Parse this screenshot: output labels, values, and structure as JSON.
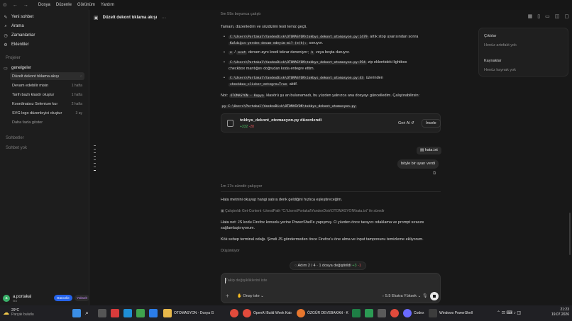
{
  "menubar": {
    "menu": [
      "Dosya",
      "Düzenle",
      "Görünüm",
      "Yardım"
    ]
  },
  "sidebar": {
    "nav": [
      {
        "label": "Yeni sohbet",
        "icon": "pencil-icon"
      },
      {
        "label": "Arama",
        "icon": "search-icon"
      },
      {
        "label": "Zamanlanlar",
        "icon": "clock-icon"
      },
      {
        "label": "Eklentiler",
        "icon": "plugin-icon"
      }
    ],
    "projects_header": "Projeler",
    "project": "genelgeler",
    "items": [
      {
        "label": "Düzelt dekont tıklama akışı",
        "meta": "",
        "active": true
      },
      {
        "label": "Devam edebilir misin",
        "meta": "1 hafta"
      },
      {
        "label": "Tarih bazlı klasör oluştur",
        "meta": "1 hafta"
      },
      {
        "label": "Koordinatsız Selenium kur",
        "meta": "2 hafta"
      },
      {
        "label": "SVG logo düzenleyici oluştur",
        "meta": "3 ay"
      }
    ],
    "show_more": "Daha fazla göster",
    "chats_header": "Sohbetler",
    "no_chats": "Sohbet yok",
    "profile": {
      "initial": "a",
      "name": "a.portakal",
      "plan": "Go",
      "update_label": "Güncelle",
      "upgrade_label": "Yükselt"
    }
  },
  "header": {
    "title": "Düzelt dekont tıklama akışı",
    "more": "···"
  },
  "content": {
    "elapsed_top": "5m 59s boyunca çalıştı",
    "intro": "Tamam, düzenledim ve sözdizimi testi temiz geçti.",
    "b1_code": "C:\\Users\\Portakal\\YandexDisk\\OTOMASYON\\tokbys_dekont_otomasyon.py:1479",
    "b1_text": "artık stop uyarısından sonra",
    "b1_code2": "Kaldığın yerden devam edeyim mi? (e/h):",
    "b1_text2": "soruyor.",
    "b2_code1": "e",
    "b2_sep": "/",
    "b2_code2": "evet",
    "b2_text": "dersen aynı kredi tekrar deneniyor;",
    "b2_code3": "h",
    "b2_text2": "veya boşta duruyor.",
    "b3_code": "C:\\Users\\Portakal\\YandexDisk\\OTOMASYON\\tokbys_dekont_otomasyon.py:594",
    "b3_text": "zip eklentideki lightbox",
    "b3_text2": "checkbox mantığını doğrudan koda entegre ettim.",
    "b4_code": "C:\\Users\\Portakal\\YandexDisk\\OTOMASYON\\tokbys_dekont_otomasyon.py:43",
    "b4_text": "üzerinden",
    "b4_code2": "checkbox_clicker_entegre=True",
    "b4_text2": "aktif.",
    "note_prefix": "Not:",
    "note_code": "OTOMASYON - Kopya",
    "note_text": "klasörü şu an bulunamadı, bu yüzden yalnızca ana dosyayı güncelledim. Çalıştırabilirsin:",
    "run_cmd": "py C:\\Users\\Portakal\\YandexDisk\\OTOMASYON\\tokbys_dekont_otomasyon.py",
    "edit_card": {
      "title": "tokbys_dekont_otomasyon.py düzenlendi",
      "added": "+332",
      "removed": "-28",
      "undo": "Geri Al ↺",
      "review": "İncele"
    },
    "attachment": "hata.txt",
    "user_message": "böyle bir uyarı verdi",
    "elapsed_mid": "1m 17s süredir çalışıyor",
    "reply1": "Hata metnini okuyup hangi satıra denk geldiğini hızlıca eşleştireceğim.",
    "ran_cmd": "Çalıştırıldı Get-Content -LiteralPath \"C:\\Users\\Portakal\\YandexDisk\\OTOMASYON\\hata.txt\" ile süredir",
    "reply2": "Hata net: JS kodu Firefox konsolu yerine PowerShell'e yapışmış. O yüzden önce tarayıcı odaklama ve prompt sırasını",
    "reply2b": "sağlamlaştırıyorum.",
    "reply3": "Kök sebep terminal odağı. Şimdi JS göndermeden önce Firefox'u öne alma ve input tamponunu temizleme ekliyorum.",
    "thinking": "Düşünüyor"
  },
  "step_banner": {
    "text": "Adım 2 / 4  ·  1 dosya değiştirildi",
    "added": "+3",
    "removed": "-1"
  },
  "composer": {
    "placeholder": "Takip değişikliklerini iste",
    "approve": "Onay iste ⌄",
    "model": "5.5  Ekstra Yüksek ⌄"
  },
  "right_panel": {
    "outputs": "Çıktılar",
    "no_artifacts": "Henüz artefakt yok",
    "sources": "Kaynaklar",
    "no_sources": "Henüz kaynak yok"
  },
  "taskbar": {
    "temp": "29°C",
    "weather": "Parçalı bulutlu",
    "apps": [
      {
        "label": "OTOMASYON - Dosya G",
        "color": "#e8b84a"
      },
      {
        "label": "OpenAI Build Week Katı",
        "color": "#e24b3c"
      },
      {
        "label": "ÖZGÜR DEVEBAKAN - K",
        "color": "#e8772e"
      },
      {
        "label": "Codex",
        "color": "#6b6bff"
      },
      {
        "label": "Windows PowerShell",
        "color": "#3c3c3c"
      }
    ],
    "time": "21:23",
    "date": "19.07.2026"
  }
}
